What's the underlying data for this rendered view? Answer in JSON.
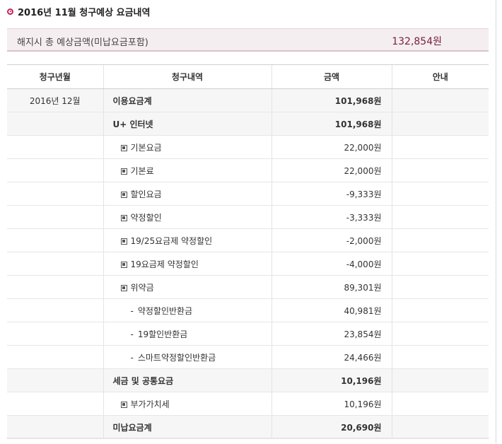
{
  "title": "2016년 11월 청구예상 요금내역",
  "summary": {
    "label": "해지시 총 예상금액(미납요금포함)",
    "value": "132,854원"
  },
  "table": {
    "headers": [
      "청구년월",
      "청구내역",
      "금액",
      "안내"
    ],
    "rows": [
      {
        "month": "2016년 12월",
        "item": "이용요금계",
        "amount": "101,968원",
        "level": 0,
        "bold": true,
        "shaded": true
      },
      {
        "month": "",
        "item": "U+ 인터넷",
        "amount": "101,968원",
        "level": 0,
        "bold": true,
        "shaded": true
      },
      {
        "month": "",
        "item": "기본요금",
        "amount": "22,000원",
        "level": 1
      },
      {
        "month": "",
        "item": "기본료",
        "amount": "22,000원",
        "level": 1
      },
      {
        "month": "",
        "item": "할인요금",
        "amount": "-9,333원",
        "level": 1
      },
      {
        "month": "",
        "item": "약정할인",
        "amount": "-3,333원",
        "level": 1
      },
      {
        "month": "",
        "item": "19/25요금제 약정할인",
        "amount": "-2,000원",
        "level": 1
      },
      {
        "month": "",
        "item": "19요금제 약정할인",
        "amount": "-4,000원",
        "level": 1
      },
      {
        "month": "",
        "item": "위약금",
        "amount": "89,301원",
        "level": 1
      },
      {
        "month": "",
        "item": "약정할인반환금",
        "amount": "40,981원",
        "level": 2
      },
      {
        "month": "",
        "item": "19할인반환금",
        "amount": "23,854원",
        "level": 2
      },
      {
        "month": "",
        "item": "스마트약정할인반환금",
        "amount": "24,466원",
        "level": 2
      },
      {
        "month": "",
        "item": "세금 및 공통요금",
        "amount": "10,196원",
        "level": 0,
        "bold": true,
        "shaded": true
      },
      {
        "month": "",
        "item": "부가가치세",
        "amount": "10,196원",
        "level": 1
      },
      {
        "month": "",
        "item": "미납요금계",
        "amount": "20,690원",
        "level": 0,
        "bold": true,
        "shaded": true
      }
    ]
  }
}
